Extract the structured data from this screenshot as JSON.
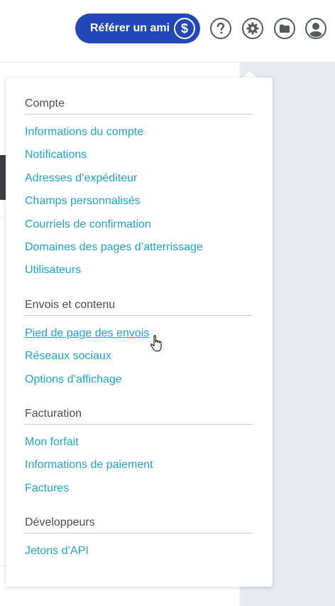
{
  "header": {
    "refer_button": {
      "label": "Référer un ami",
      "icon": "dollar-icon",
      "glyph": "$"
    },
    "icons": [
      "help-icon",
      "settings-gear-icon",
      "folder-icon",
      "user-avatar-icon"
    ],
    "colors": {
      "accent": "#2147b8",
      "link": "#1fa3d2",
      "heading": "#4a4f55"
    }
  },
  "menu": {
    "sections": [
      {
        "title": "Compte",
        "items": [
          "Informations du compte",
          "Notifications",
          "Adresses d’expéditeur",
          "Champs personnalisés",
          "Courriels de confirmation",
          "Domaines des pages d’atterrissage",
          "Utilisateurs"
        ]
      },
      {
        "title": "Envois et contenu",
        "items": [
          "Pied de page des envois",
          "Réseaux sociaux",
          "Options d’affichage"
        ]
      },
      {
        "title": "Facturation",
        "items": [
          "Mon forfait",
          "Informations de paiement",
          "Factures"
        ]
      },
      {
        "title": "Développeurs",
        "items": [
          "Jetons d’API"
        ]
      }
    ],
    "hovered_item": "Pied de page des envois"
  }
}
